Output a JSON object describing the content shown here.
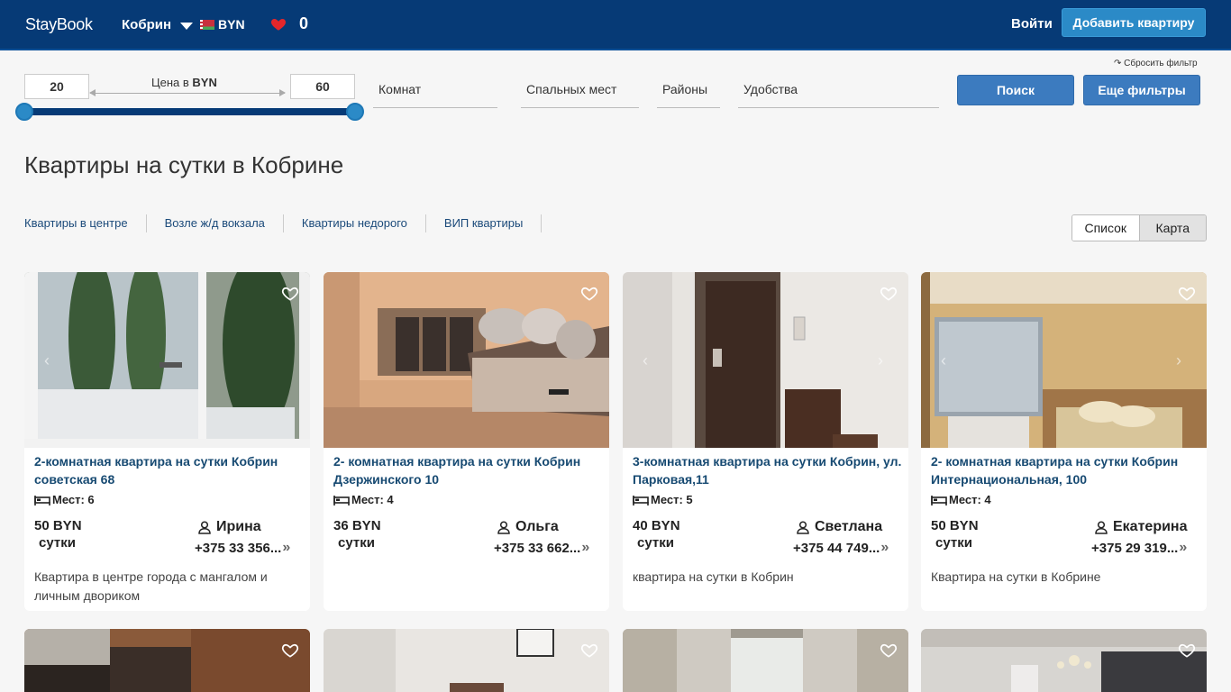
{
  "header": {
    "logo": "StayBook",
    "city": "Кобрин",
    "currency": "BYN",
    "favorites_count": "0",
    "login": "Войти",
    "add_button": "Добавить квартиру"
  },
  "filters": {
    "reset": "↷ Сбросить фильтр",
    "price_min": "20",
    "price_max": "60",
    "price_label_prefix": "Цена в ",
    "price_label_currency": "BYN",
    "rooms": "Комнат",
    "beds": "Спальных мест",
    "districts": "Районы",
    "amenities": "Удобства",
    "search_button": "Поиск",
    "more_filters_button": "Еще фильтры"
  },
  "page_title": "Квартиры на сутки в Кобрине",
  "quick_links": [
    "Квартиры в центре",
    "Возле ж/д вокзала",
    "Квартиры недорого",
    "ВИП квартиры"
  ],
  "view_toggle": {
    "list": "Список",
    "map": "Карта"
  },
  "cards": [
    {
      "title": "2-комнатная квартира на сутки Кобрин советская 68",
      "places": "Мест: 6",
      "price": "50 BYN",
      "unit": "сутки",
      "owner": "Ирина",
      "phone": "+375 33 356...",
      "description": "Квартира в центре города с мангалом и личным двориком"
    },
    {
      "title": "2- комнатная квартира на сутки Кобрин Дзержинского 10",
      "places": "Мест: 4",
      "price": "36 BYN",
      "unit": "сутки",
      "owner": "Ольга",
      "phone": "+375 33 662...",
      "description": ""
    },
    {
      "title": "3-комнатная квартира на сутки Кобрин, ул. Парковая,11",
      "places": "Мест: 5",
      "price": "40 BYN",
      "unit": "сутки",
      "owner": "Светлана",
      "phone": "+375 44 749...",
      "description": "квартира на сутки в Кобрин"
    },
    {
      "title": "2- комнатная квартира на сутки Кобрин Интернациональная, 100",
      "places": "Мест: 4",
      "price": "50 BYN",
      "unit": "сутки",
      "owner": "Екатерина",
      "phone": "+375 29 319...",
      "description": "Квартира на сутки в Кобрине"
    }
  ],
  "colors": {
    "header_bg": "#063a76",
    "accent": "#2b8ac7",
    "title_link": "#174a72"
  }
}
